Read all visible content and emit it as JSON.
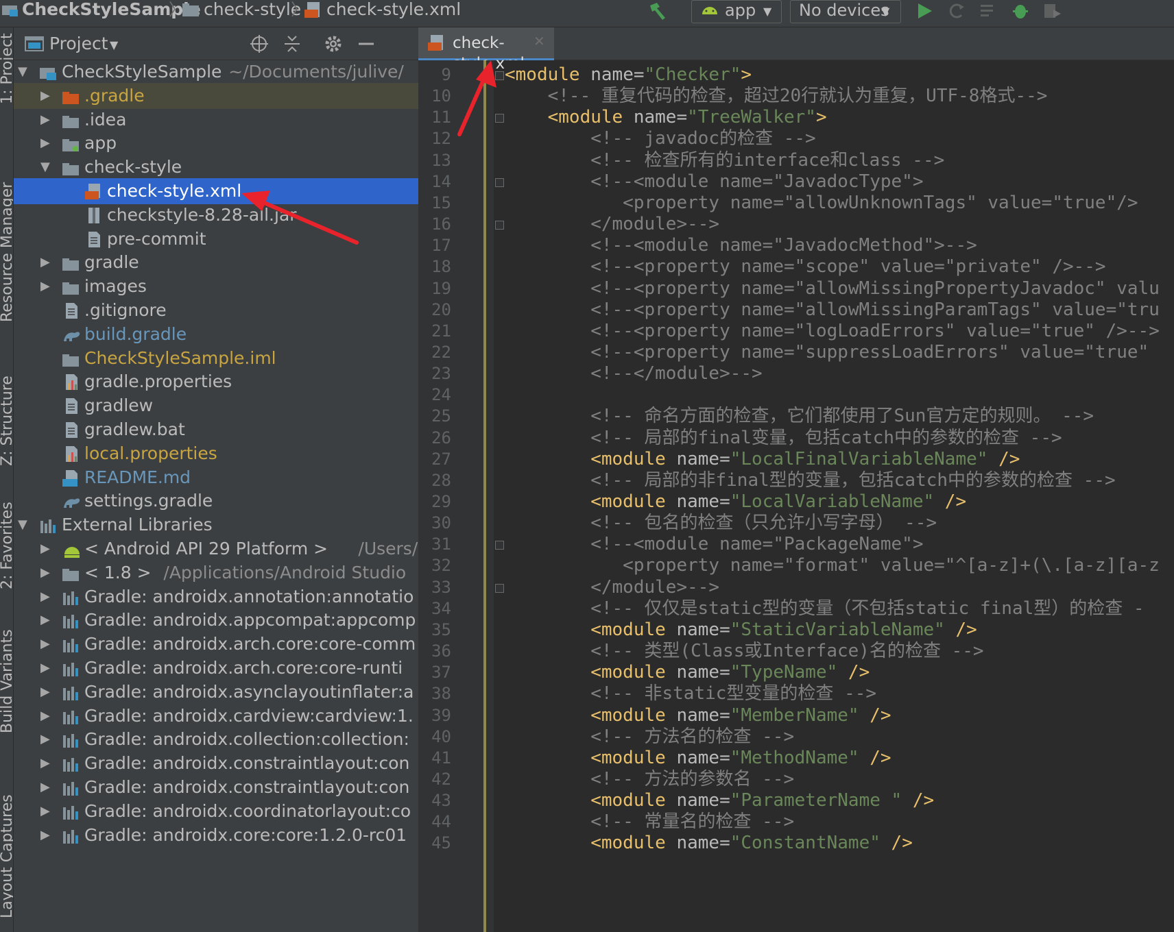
{
  "toolbar": {
    "breadcrumbs": [
      "CheckStyleSample",
      "check-style",
      "check-style.xml"
    ],
    "run_config": "app",
    "device": "No devices"
  },
  "left_strip": {
    "tabs": [
      "1: Project",
      "Resource Manager",
      "Z: Structure",
      "2: Favorites",
      "Build Variants",
      "Layout Captures"
    ]
  },
  "project_panel": {
    "title": "Project",
    "rows": [
      {
        "label": "CheckStyleSample",
        "suffix": "~/Documents/julive/",
        "indent": 0,
        "arrow": "down",
        "icon": "module",
        "color": "#bbbbbb"
      },
      {
        "label": ".gradle",
        "indent": 1,
        "arrow": "right",
        "icon": "folder-orange",
        "color": "#c9a542",
        "row": "gr"
      },
      {
        "label": ".idea",
        "indent": 1,
        "arrow": "right",
        "icon": "folder",
        "color": "#bbbbbb"
      },
      {
        "label": "app",
        "indent": 1,
        "arrow": "right",
        "icon": "folder-green",
        "color": "#bbbbbb"
      },
      {
        "label": "check-style",
        "indent": 1,
        "arrow": "down",
        "icon": "folder",
        "color": "#bbbbbb"
      },
      {
        "label": "check-style.xml",
        "indent": 2,
        "arrow": "",
        "icon": "xml",
        "color": "#ffffff",
        "row": "sel"
      },
      {
        "label": "checkstyle-8.28-all.jar",
        "indent": 2,
        "arrow": "",
        "icon": "jar",
        "color": "#bbbbbb"
      },
      {
        "label": "pre-commit",
        "indent": 2,
        "arrow": "",
        "icon": "file",
        "color": "#bbbbbb"
      },
      {
        "label": "gradle",
        "indent": 1,
        "arrow": "right",
        "icon": "folder",
        "color": "#bbbbbb"
      },
      {
        "label": "images",
        "indent": 1,
        "arrow": "right",
        "icon": "folder",
        "color": "#bbbbbb"
      },
      {
        "label": ".gitignore",
        "indent": 1,
        "arrow": "",
        "icon": "file",
        "color": "#bbbbbb"
      },
      {
        "label": "build.gradle",
        "indent": 1,
        "arrow": "",
        "icon": "gradle",
        "color": "#6897bb"
      },
      {
        "label": "CheckStyleSample.iml",
        "indent": 1,
        "arrow": "",
        "icon": "folder",
        "color": "#c9a542"
      },
      {
        "label": "gradle.properties",
        "indent": 1,
        "arrow": "",
        "icon": "props",
        "color": "#bbbbbb"
      },
      {
        "label": "gradlew",
        "indent": 1,
        "arrow": "",
        "icon": "file",
        "color": "#bbbbbb"
      },
      {
        "label": "gradlew.bat",
        "indent": 1,
        "arrow": "",
        "icon": "file",
        "color": "#bbbbbb"
      },
      {
        "label": "local.properties",
        "indent": 1,
        "arrow": "",
        "icon": "props",
        "color": "#c9a542"
      },
      {
        "label": "README.md",
        "indent": 1,
        "arrow": "",
        "icon": "md",
        "color": "#6897bb"
      },
      {
        "label": "settings.gradle",
        "indent": 1,
        "arrow": "",
        "icon": "gradle",
        "color": "#bbbbbb"
      },
      {
        "label": "External Libraries",
        "indent": 0,
        "arrow": "down",
        "icon": "lib",
        "color": "#bbbbbb"
      },
      {
        "label": "< Android API 29 Platform >",
        "suffix": "/Users/r",
        "indent": 1,
        "arrow": "right",
        "icon": "android",
        "color": "#bbbbbb"
      },
      {
        "label": "< 1.8 >",
        "suffix": "/Applications/Android Studio",
        "indent": 1,
        "arrow": "right",
        "icon": "folder",
        "color": "#bbbbbb"
      },
      {
        "label": "Gradle: androidx.annotation:annotatio",
        "indent": 1,
        "arrow": "right",
        "icon": "lib",
        "color": "#bbbbbb"
      },
      {
        "label": "Gradle: androidx.appcompat:appcomp",
        "indent": 1,
        "arrow": "right",
        "icon": "lib",
        "color": "#bbbbbb"
      },
      {
        "label": "Gradle: androidx.arch.core:core-comm",
        "indent": 1,
        "arrow": "right",
        "icon": "lib",
        "color": "#bbbbbb"
      },
      {
        "label": "Gradle: androidx.arch.core:core-runti",
        "indent": 1,
        "arrow": "right",
        "icon": "lib",
        "color": "#bbbbbb"
      },
      {
        "label": "Gradle: androidx.asynclayoutinflater:a",
        "indent": 1,
        "arrow": "right",
        "icon": "lib",
        "color": "#bbbbbb"
      },
      {
        "label": "Gradle: androidx.cardview:cardview:1.",
        "indent": 1,
        "arrow": "right",
        "icon": "lib",
        "color": "#bbbbbb"
      },
      {
        "label": "Gradle: androidx.collection:collection:",
        "indent": 1,
        "arrow": "right",
        "icon": "lib",
        "color": "#bbbbbb"
      },
      {
        "label": "Gradle: androidx.constraintlayout:con",
        "indent": 1,
        "arrow": "right",
        "icon": "lib",
        "color": "#bbbbbb"
      },
      {
        "label": "Gradle: androidx.constraintlayout:con",
        "indent": 1,
        "arrow": "right",
        "icon": "lib",
        "color": "#bbbbbb"
      },
      {
        "label": "Gradle: androidx.coordinatorlayout:co",
        "indent": 1,
        "arrow": "right",
        "icon": "lib",
        "color": "#bbbbbb"
      },
      {
        "label": "Gradle: androidx.core:core:1.2.0-rc01",
        "indent": 1,
        "arrow": "right",
        "icon": "lib",
        "color": "#bbbbbb"
      }
    ]
  },
  "editor": {
    "tab_label": "check-style.xml",
    "lines": [
      {
        "n": "9",
        "segs": [
          [
            "tag",
            "<module"
          ],
          [
            "attr",
            " name="
          ],
          [
            "val",
            "\"Checker\""
          ],
          [
            "tag",
            ">"
          ]
        ]
      },
      {
        "n": "10",
        "segs": [
          [
            "cmt",
            "    <!-- 重复代码的检查，超过20行就认为重复，UTF-8格式-->"
          ]
        ]
      },
      {
        "n": "11",
        "segs": [
          [
            "tag",
            "    <module"
          ],
          [
            "attr",
            " name="
          ],
          [
            "val",
            "\"TreeWalker\""
          ],
          [
            "tag",
            ">"
          ]
        ]
      },
      {
        "n": "12",
        "segs": [
          [
            "cmt",
            "        <!-- javadoc的检查 -->"
          ]
        ]
      },
      {
        "n": "13",
        "segs": [
          [
            "cmt",
            "        <!-- 检查所有的interface和class -->"
          ]
        ]
      },
      {
        "n": "14",
        "segs": [
          [
            "cmt",
            "        <!--<module name=\"JavadocType\">"
          ]
        ]
      },
      {
        "n": "15",
        "segs": [
          [
            "cmt",
            "           <property name=\"allowUnknownTags\" value=\"true\"/>"
          ]
        ]
      },
      {
        "n": "16",
        "segs": [
          [
            "cmt",
            "        </module>-->"
          ]
        ]
      },
      {
        "n": "17",
        "segs": [
          [
            "cmt",
            "        <!--<module name=\"JavadocMethod\">-->"
          ]
        ]
      },
      {
        "n": "18",
        "segs": [
          [
            "cmt",
            "        <!--<property name=\"scope\" value=\"private\" />-->"
          ]
        ]
      },
      {
        "n": "19",
        "segs": [
          [
            "cmt",
            "        <!--<property name=\"allowMissingPropertyJavadoc\" valu"
          ]
        ]
      },
      {
        "n": "20",
        "segs": [
          [
            "cmt",
            "        <!--<property name=\"allowMissingParamTags\" value=\"tru"
          ]
        ]
      },
      {
        "n": "21",
        "segs": [
          [
            "cmt",
            "        <!--<property name=\"logLoadErrors\" value=\"true\" />-->"
          ]
        ]
      },
      {
        "n": "22",
        "segs": [
          [
            "cmt",
            "        <!--<property name=\"suppressLoadErrors\" value=\"true\""
          ]
        ]
      },
      {
        "n": "23",
        "segs": [
          [
            "cmt",
            "        <!--</module>-->"
          ]
        ]
      },
      {
        "n": "24",
        "segs": [
          [
            "cmt",
            ""
          ]
        ]
      },
      {
        "n": "25",
        "segs": [
          [
            "cmt",
            "        <!-- 命名方面的检查，它们都使用了Sun官方定的规则。 -->"
          ]
        ]
      },
      {
        "n": "26",
        "segs": [
          [
            "cmt",
            "        <!-- 局部的final变量，包括catch中的参数的检查 -->"
          ]
        ]
      },
      {
        "n": "27",
        "segs": [
          [
            "tag",
            "        <module"
          ],
          [
            "attr",
            " name="
          ],
          [
            "val",
            "\"LocalFinalVariableName\""
          ],
          [
            "tag",
            " />"
          ]
        ]
      },
      {
        "n": "28",
        "segs": [
          [
            "cmt",
            "        <!-- 局部的非final型的变量，包括catch中的参数的检查 -->"
          ]
        ]
      },
      {
        "n": "29",
        "segs": [
          [
            "tag",
            "        <module"
          ],
          [
            "attr",
            " name="
          ],
          [
            "val",
            "\"LocalVariableName\""
          ],
          [
            "tag",
            " />"
          ]
        ]
      },
      {
        "n": "30",
        "segs": [
          [
            "cmt",
            "        <!-- 包名的检查（只允许小写字母） -->"
          ]
        ]
      },
      {
        "n": "31",
        "segs": [
          [
            "cmt",
            "        <!--<module name=\"PackageName\">"
          ]
        ]
      },
      {
        "n": "32",
        "segs": [
          [
            "cmt",
            "           <property name=\"format\" value=\"^[a-z]+(\\.[a-z][a-z"
          ]
        ]
      },
      {
        "n": "33",
        "segs": [
          [
            "cmt",
            "        </module>-->"
          ]
        ]
      },
      {
        "n": "34",
        "segs": [
          [
            "cmt",
            "        <!-- 仅仅是static型的变量（不包括static final型）的检查 -"
          ]
        ]
      },
      {
        "n": "35",
        "segs": [
          [
            "tag",
            "        <module"
          ],
          [
            "attr",
            " name="
          ],
          [
            "val",
            "\"StaticVariableName\""
          ],
          [
            "tag",
            " />"
          ]
        ]
      },
      {
        "n": "36",
        "segs": [
          [
            "cmt",
            "        <!-- 类型(Class或Interface)名的检查 -->"
          ]
        ]
      },
      {
        "n": "37",
        "segs": [
          [
            "tag",
            "        <module"
          ],
          [
            "attr",
            " name="
          ],
          [
            "val",
            "\"TypeName\""
          ],
          [
            "tag",
            " />"
          ]
        ]
      },
      {
        "n": "38",
        "segs": [
          [
            "cmt",
            "        <!-- 非static型变量的检查 -->"
          ]
        ]
      },
      {
        "n": "39",
        "segs": [
          [
            "tag",
            "        <module"
          ],
          [
            "attr",
            " name="
          ],
          [
            "val",
            "\"MemberName\""
          ],
          [
            "tag",
            " />"
          ]
        ]
      },
      {
        "n": "40",
        "segs": [
          [
            "cmt",
            "        <!-- 方法名的检查 -->"
          ]
        ]
      },
      {
        "n": "41",
        "segs": [
          [
            "tag",
            "        <module"
          ],
          [
            "attr",
            " name="
          ],
          [
            "val",
            "\"MethodName\""
          ],
          [
            "tag",
            " />"
          ]
        ]
      },
      {
        "n": "42",
        "segs": [
          [
            "cmt",
            "        <!-- 方法的参数名 -->"
          ]
        ]
      },
      {
        "n": "43",
        "segs": [
          [
            "tag",
            "        <module"
          ],
          [
            "attr",
            " name="
          ],
          [
            "val",
            "\"ParameterName \""
          ],
          [
            "tag",
            " />"
          ]
        ]
      },
      {
        "n": "44",
        "segs": [
          [
            "cmt",
            "        <!-- 常量名的检查 -->"
          ]
        ]
      },
      {
        "n": "45",
        "segs": [
          [
            "tag",
            "        <module"
          ],
          [
            "attr",
            " name="
          ],
          [
            "val",
            "\"ConstantName\""
          ],
          [
            "tag",
            " />"
          ]
        ]
      }
    ]
  },
  "colors": {
    "accent": "#2f65ca",
    "tag": "#e8bf6a",
    "value": "#6a8759",
    "comment": "#808080",
    "annotation": "#e8232b"
  },
  "icons": [
    "project-icon",
    "folder-icon",
    "locate-icon",
    "collapse-icon",
    "gear-icon",
    "minimize-icon",
    "hammer-icon",
    "android-icon",
    "run-icon",
    "debug-icon",
    "xml-file-icon"
  ]
}
